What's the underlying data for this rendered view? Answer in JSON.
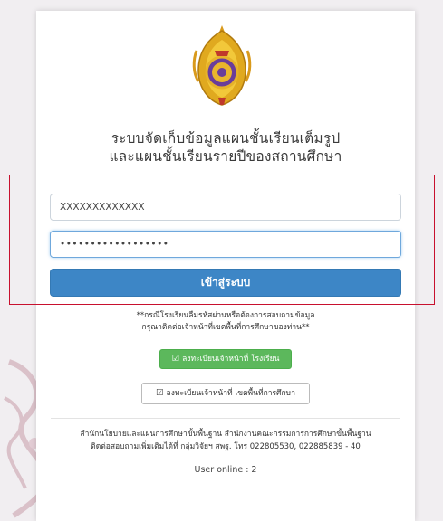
{
  "header": {
    "title_line1": "ระบบจัดเก็บข้อมูลแผนชั้นเรียนเต็มรูป",
    "title_line2": "และแผนชั้นเรียนรายปีของสถานศึกษา"
  },
  "login_form": {
    "username_value": "XXXXXXXXXXXXX",
    "password_value": "••••••••••••••••••",
    "login_button_label": "เข้าสู่ระบบ"
  },
  "notice": {
    "line1": "**กรณีโรงเรียนลืมรหัสผ่านหรือต้องการสอบถามข้อมูล",
    "line2": "กรุณาติดต่อเจ้าหน้าที่เขตพื้นที่การศึกษาของท่าน**"
  },
  "register_buttons": {
    "school_staff_label": "ลงทะเบียนเจ้าหน้าที่ โรงเรียน",
    "area_staff_label": "ลงทะเบียนเจ้าหน้าที่ เขตพื้นที่การศึกษา",
    "icon_glyph": "☑"
  },
  "footer": {
    "line1": "สำนักนโยบายและแผนการศึกษาขั้นพื้นฐาน สำนักงานคณะกรรมการการศึกษาขั้นพื้นฐาน",
    "line2": "ติดต่อสอบถามเพิ่มเติมได้ที่ กลุ่มวิจัยฯ สพฐ. โทร 022805530, 022885839 - 40",
    "user_online": "User online : 2"
  },
  "colors": {
    "primary": "#3d86c6",
    "success": "#5cb85c",
    "highlight": "#c8102e",
    "background": "#f1eef1"
  },
  "icons": {
    "logo": "obec-emblem-icon",
    "edit": "edit-icon"
  }
}
